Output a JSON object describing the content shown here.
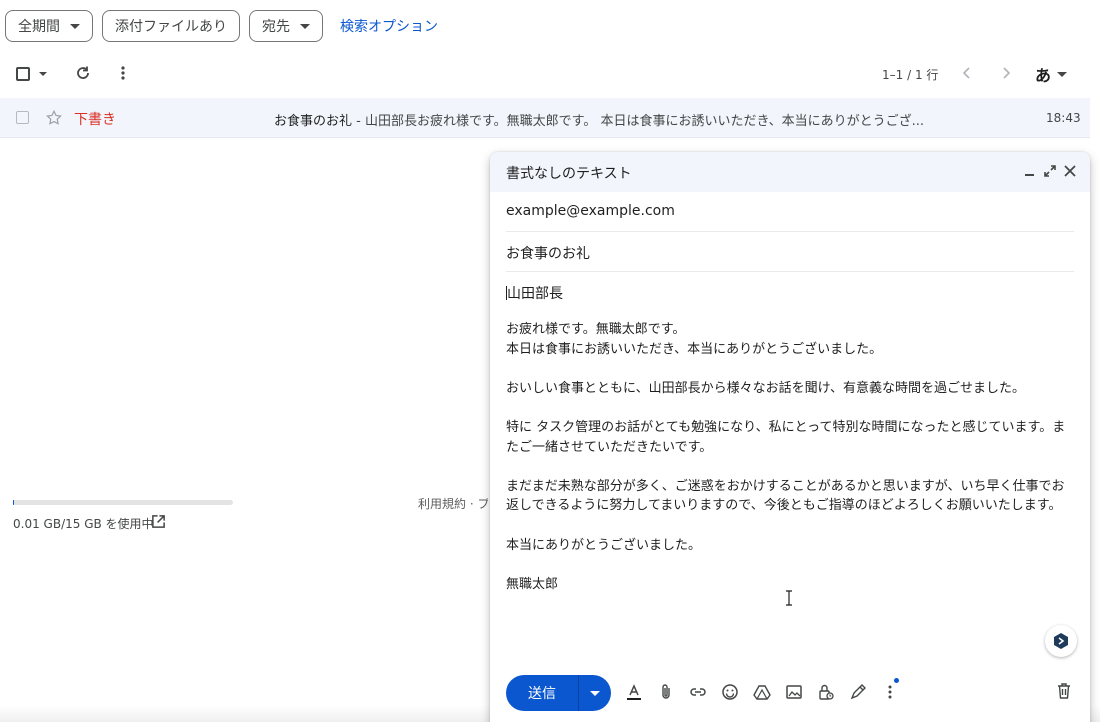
{
  "filters": {
    "period": "全期間",
    "attachment": "添付ファイルあり",
    "recipient": "宛先",
    "search_options": "検索オプション"
  },
  "toolbar": {
    "pager": "1–1 / 1 行",
    "ime": "あ"
  },
  "row": {
    "sender": "下書き",
    "subject": "お食事のお礼",
    "separator": " - ",
    "snippet": "山田部長お疲れ様です。無職太郎です。 本日は食事にお誘いいただき、本当にありがとうござ...",
    "time": "18:43"
  },
  "storage": {
    "text": "0.01 GB/15 GB を使用中",
    "fraction": 0.0007
  },
  "footer": {
    "links": "利用規約 · プ"
  },
  "compose": {
    "title": "書式なしのテキスト",
    "to": "example@example.com",
    "subject": "お食事のお礼",
    "body_greeting": "山田部長",
    "body": [
      "お疲れ様です。無職太郎です。",
      "本日は食事にお誘いいただき、本当にありがとうございました。",
      "",
      "おいしい食事とともに、山田部長から様々なお話を聞け、有意義な時間を過ごせました。",
      "",
      "特に タスク管理のお話がとても勉強になり、私にとって特別な時間になったと感じています。またご一緒させていただきたいです。",
      "",
      "まだまだ未熟な部分が多く、ご迷惑をおかけすることがあるかと思いますが、いち早く仕事でお返しできるように努力してまいりますので、今後ともご指導のほどよろしくお願いいたします。",
      "",
      "本当にありがとうございました。",
      "",
      "無職太郎"
    ],
    "send_label": "送信"
  },
  "colors": {
    "accent": "#0b57d0",
    "draft_red": "#d93025",
    "row_bg": "#f2f6fc"
  }
}
